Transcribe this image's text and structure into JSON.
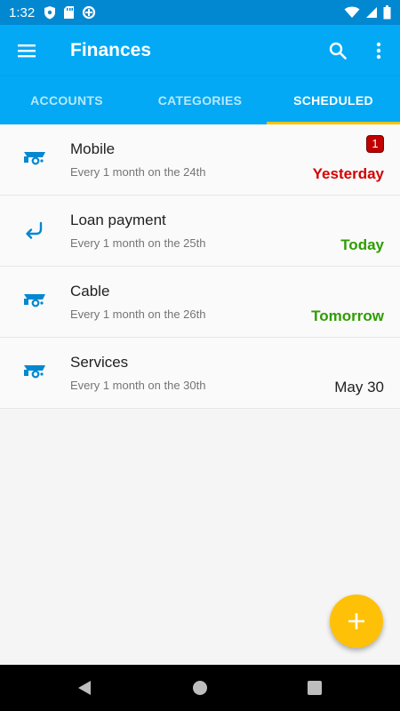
{
  "status_bar": {
    "time": "1:32",
    "left_icons": [
      "shield-icon",
      "sd-card-icon",
      "data-saver-icon"
    ],
    "right_icons": [
      "wifi-icon",
      "cell-signal-icon",
      "battery-icon"
    ]
  },
  "toolbar": {
    "title": "Finances",
    "menu_icon": "hamburger-menu-icon",
    "search_icon": "search-icon",
    "more_icon": "more-vert-icon"
  },
  "tabs": [
    {
      "label": "ACCOUNTS",
      "active": false
    },
    {
      "label": "CATEGORIES",
      "active": false
    },
    {
      "label": "SCHEDULED",
      "active": true
    }
  ],
  "scheduled": [
    {
      "title": "Mobile",
      "recurrence": "Every 1 month on the 24th",
      "when": "Yesterday",
      "when_color": "#d50000",
      "badge": "1",
      "icon": "payment-icon"
    },
    {
      "title": "Loan payment",
      "recurrence": "Every 1 month on the 25th",
      "when": "Today",
      "when_color": "#2e9d00",
      "icon": "return-arrow-icon"
    },
    {
      "title": "Cable",
      "recurrence": "Every 1 month on the 26th",
      "when": "Tomorrow",
      "when_color": "#2e9d00",
      "icon": "payment-icon"
    },
    {
      "title": "Services",
      "recurrence": "Every 1 month on the 30th",
      "when": "May 30",
      "when_color": "#212121",
      "icon": "payment-icon"
    }
  ],
  "fab": {
    "icon": "plus-icon"
  },
  "nav_bar": {
    "icons": [
      "back-icon",
      "home-icon",
      "recents-icon"
    ]
  },
  "colors": {
    "primary": "#03a9f4",
    "primary_dark": "#0288d1",
    "accent": "#ffc107",
    "overdue": "#d50000",
    "upcoming": "#2e9d00"
  }
}
